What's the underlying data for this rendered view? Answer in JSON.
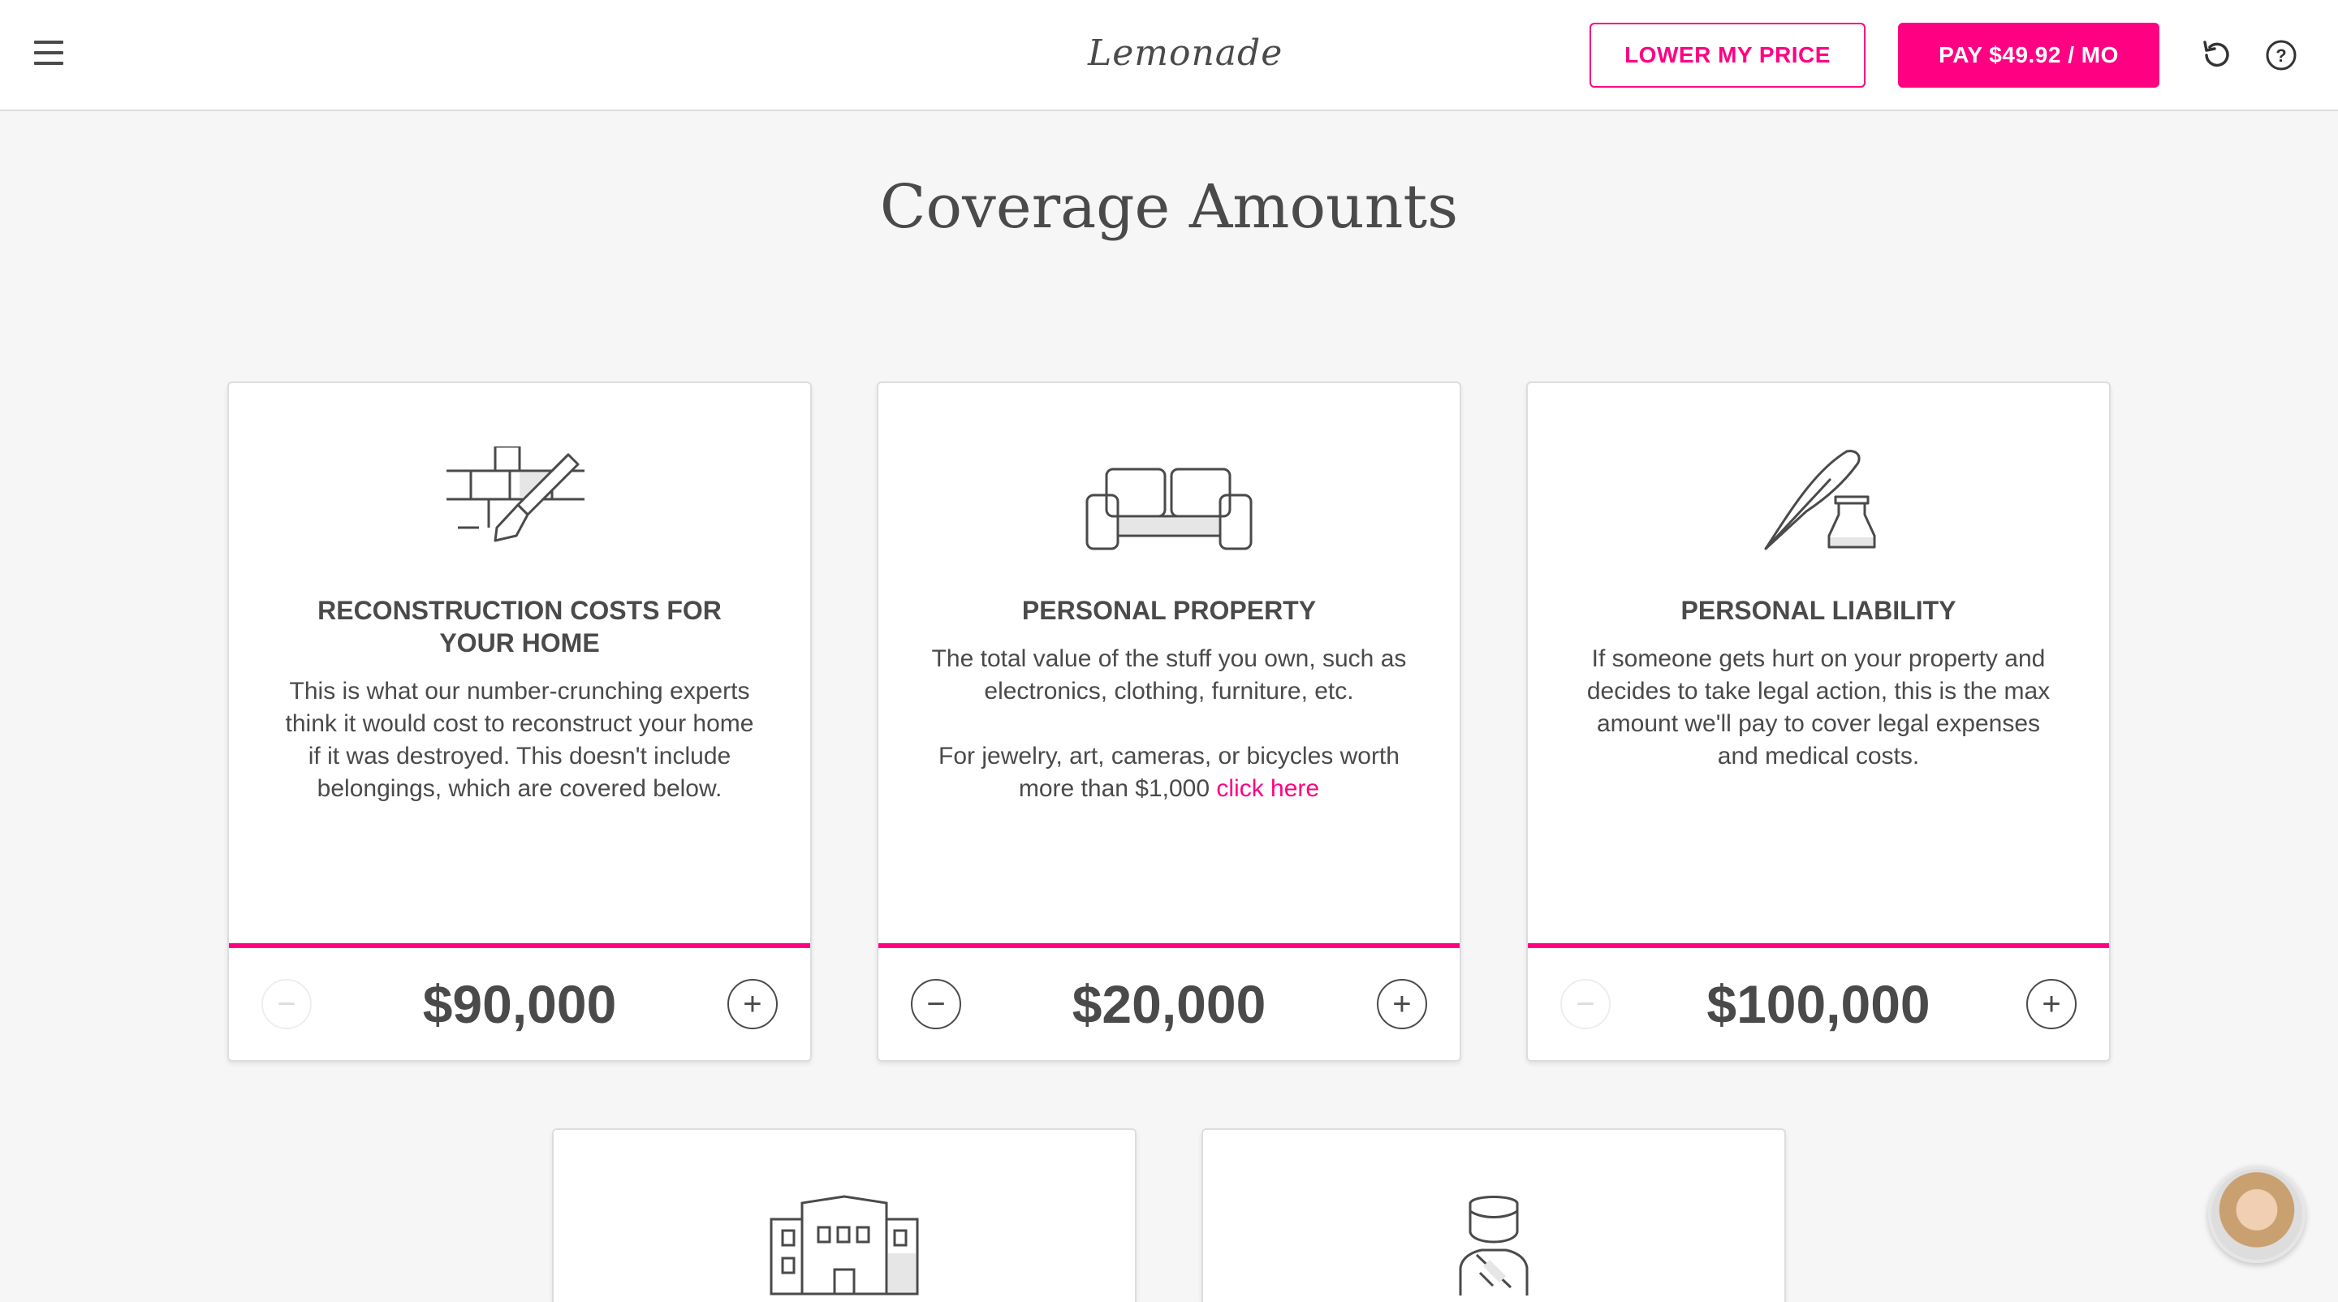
{
  "header": {
    "logo_text": "Lemonade",
    "lower_price_label": "LOWER MY PRICE",
    "pay_label": "PAY $49.92 / MO",
    "icons": [
      "menu-icon",
      "undo-icon",
      "help-icon"
    ]
  },
  "page": {
    "title": "Coverage Amounts"
  },
  "cards": [
    {
      "icon": "bricks-trowel-icon",
      "title": "RECONSTRUCTION COSTS FOR YOUR HOME",
      "description": "This is what our number-crunching experts think it would cost to reconstruct your home if it was destroyed. This doesn't include belongings, which are covered below.",
      "amount": "$90,000",
      "minus": "−",
      "plus": "+",
      "minus_enabled": false
    },
    {
      "icon": "sofa-icon",
      "title": "PERSONAL PROPERTY",
      "description": "The total value of the stuff you own, such as electronics, clothing, furniture, etc.",
      "description_2": "For jewelry, art, cameras, or bicycles worth more than $1,000",
      "link": "click here",
      "amount": "$20,000",
      "minus": "−",
      "plus": "+",
      "minus_enabled": true
    },
    {
      "icon": "quill-inkwell-icon",
      "title": "PERSONAL LIABILITY",
      "description": "If someone gets hurt on your property and decides to take legal action, this is the max amount we'll pay to cover legal expenses and medical costs.",
      "amount": "$100,000",
      "minus": "−",
      "plus": "+",
      "minus_enabled": false
    },
    {
      "icon": "building-icon"
    },
    {
      "icon": "injured-person-icon"
    }
  ],
  "colors": {
    "accent": "#ff0083",
    "text": "#4a4a4a",
    "background": "#f6f6f6"
  }
}
